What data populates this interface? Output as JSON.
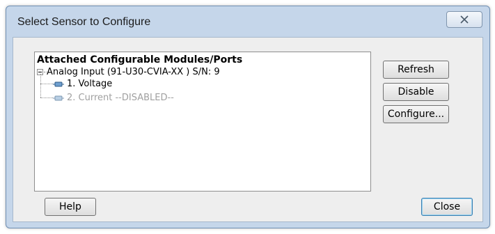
{
  "window": {
    "title": "Select Sensor to Configure",
    "close_icon": "close-icon"
  },
  "tree": {
    "header": "Attached Configurable Modules/Ports",
    "root": {
      "label": "Analog Input (91-U30-CVIA-XX ) S/N: 9",
      "expanded": true,
      "children": [
        {
          "label": "1.  Voltage",
          "enabled": true,
          "icon": "port-icon"
        },
        {
          "label": "2. Current --DISABLED--",
          "enabled": false,
          "icon": "port-icon"
        }
      ]
    }
  },
  "buttons": {
    "refresh": "Refresh",
    "disable": "Disable",
    "configure": "Configure...",
    "help": "Help",
    "close": "Close"
  },
  "colors": {
    "frame": "#c5d6ea",
    "client": "#eeeeee",
    "disabled_text": "#a0a0a0",
    "default_button_border": "#3c7fb1"
  }
}
